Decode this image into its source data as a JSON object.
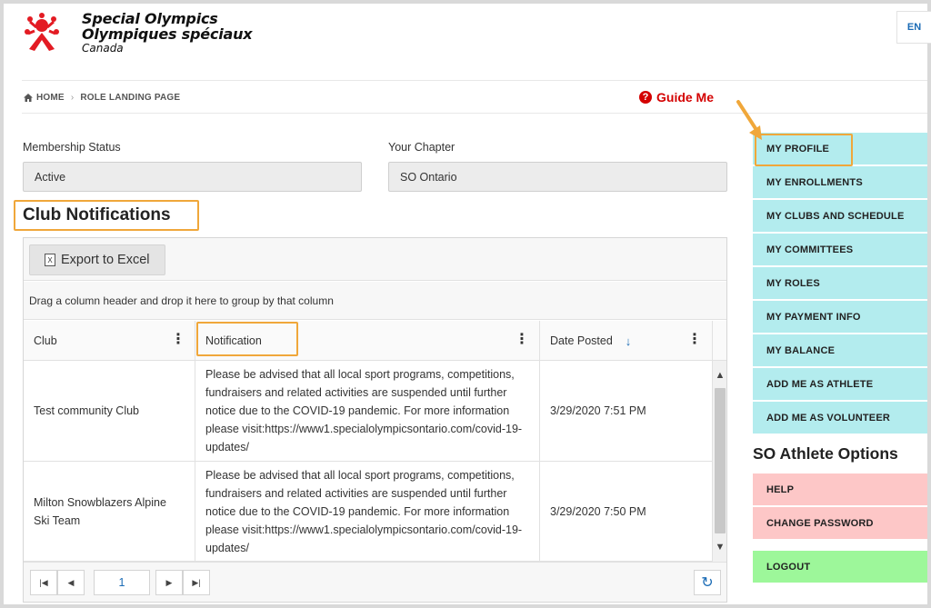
{
  "header": {
    "logo_line1": "Special Olympics",
    "logo_line2": "Olympiques spéciaux",
    "logo_line3": "Canada",
    "language": "EN",
    "guide_me": "Guide Me"
  },
  "breadcrumb": {
    "home": "HOME",
    "current": "ROLE LANDING PAGE"
  },
  "membership": {
    "label": "Membership Status",
    "value": "Active"
  },
  "chapter": {
    "label": "Your Chapter",
    "value": "SO Ontario"
  },
  "section_title": "Club Notifications",
  "grid": {
    "export_label": "Export to Excel",
    "group_hint": "Drag a column header and drop it here to group by that column",
    "columns": [
      "Club",
      "Notification",
      "Date Posted"
    ],
    "rows": [
      {
        "club": "Test community Club",
        "notification": "Please be advised that all local sport programs, competitions, fundraisers and related activities are suspended until further notice due to the COVID-19 pandemic. For more information please visit:https://www1.specialolympicsontario.com/covid-19-updates/",
        "date": "3/29/2020 7:51 PM"
      },
      {
        "club": "Milton Snowblazers Alpine Ski Team",
        "notification": "Please be advised that all local sport programs, competitions, fundraisers and related activities are suspended until further notice due to the COVID-19 pandemic. For more information please visit:https://www1.specialolympicsontario.com/covid-19-updates/",
        "date": "3/29/2020 7:50 PM"
      }
    ],
    "page": "1"
  },
  "sidebar": {
    "items": [
      "MY PROFILE",
      "MY ENROLLMENTS",
      "MY CLUBS AND SCHEDULE",
      "MY COMMITTEES",
      "MY ROLES",
      "MY PAYMENT INFO",
      "MY BALANCE",
      "ADD ME AS ATHLETE",
      "ADD ME AS VOLUNTEER"
    ],
    "athlete_options_title": "SO Athlete Options",
    "help": "HELP",
    "change_password": "CHANGE PASSWORD",
    "logout": "LOGOUT"
  },
  "colors": {
    "menu_cyan": "#b3ecee",
    "menu_pink": "#fdc7c7",
    "menu_green": "#9df79a",
    "highlight_orange": "#f0a73a",
    "guide_red": "#d40000",
    "link_blue": "#1a6bb5"
  }
}
